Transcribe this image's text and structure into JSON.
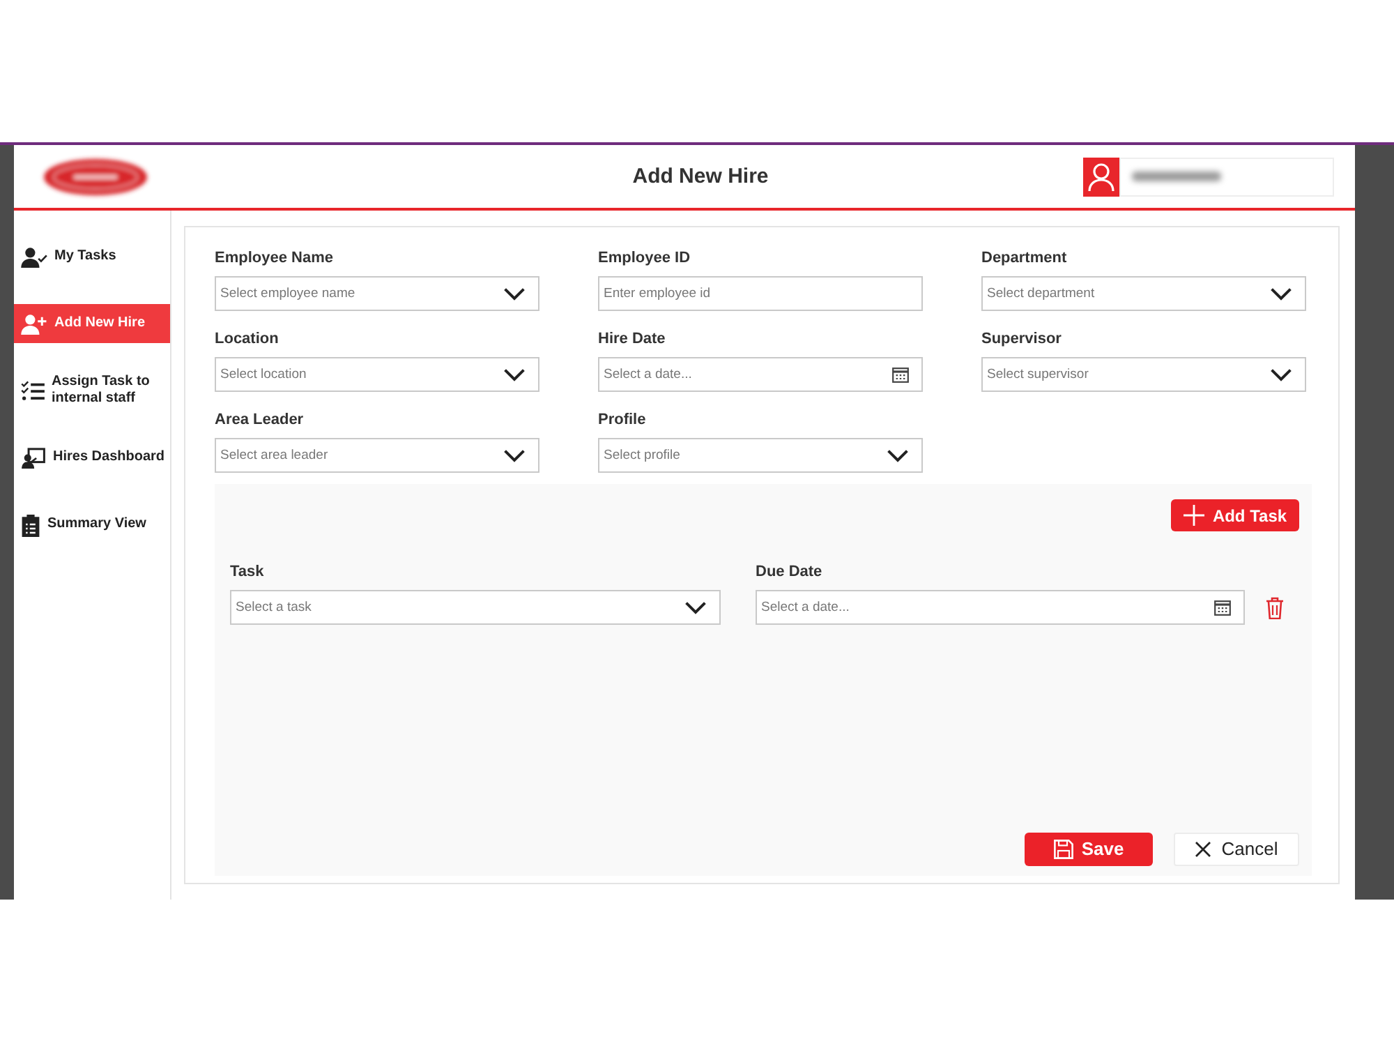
{
  "header": {
    "title": "Add New Hire"
  },
  "sidebar": {
    "items": [
      {
        "label": "My Tasks",
        "selected": false
      },
      {
        "label": "Add New Hire",
        "selected": true
      },
      {
        "label": "Assign Task to internal staff",
        "selected": false
      },
      {
        "label": "Hires Dashboard",
        "selected": false
      },
      {
        "label": "Summary View",
        "selected": false
      }
    ]
  },
  "form": {
    "fields": [
      {
        "label": "Employee Name",
        "placeholder": "Select employee name",
        "kind": "dropdown"
      },
      {
        "label": "Employee ID",
        "placeholder": "Enter employee id",
        "kind": "text"
      },
      {
        "label": "Department",
        "placeholder": "Select department",
        "kind": "dropdown"
      },
      {
        "label": "Location",
        "placeholder": "Select location",
        "kind": "dropdown"
      },
      {
        "label": "Hire Date",
        "placeholder": "Select a date...",
        "kind": "date"
      },
      {
        "label": "Supervisor",
        "placeholder": "Select supervisor",
        "kind": "dropdown"
      },
      {
        "label": "Area Leader",
        "placeholder": "Select area leader",
        "kind": "dropdown"
      },
      {
        "label": "Profile",
        "placeholder": "Select profile",
        "kind": "dropdown"
      }
    ]
  },
  "tasks_panel": {
    "add_button": {
      "label": "Add Task"
    },
    "tasks": [
      {
        "fields": [
          {
            "label": "Task",
            "placeholder": "Select a task",
            "kind": "dropdown"
          },
          {
            "label": "Due Date",
            "placeholder": "Select a date...",
            "kind": "date"
          }
        ]
      }
    ]
  },
  "actions": [
    {
      "label": "Save",
      "kind": "primary"
    },
    {
      "label": "Cancel",
      "kind": "secondary"
    }
  ]
}
